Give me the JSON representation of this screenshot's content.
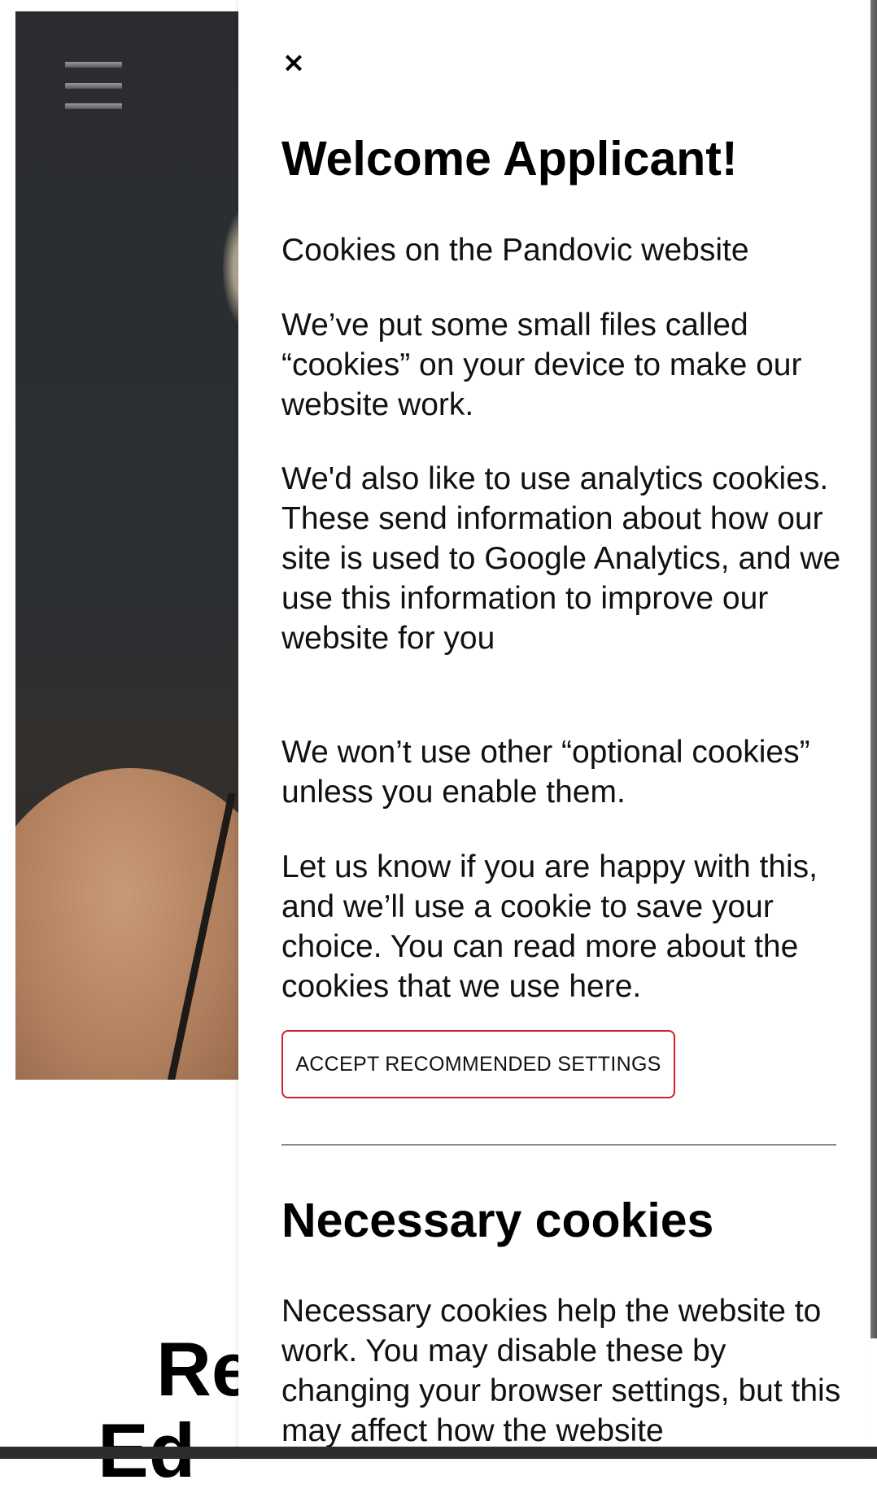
{
  "background": {
    "menu_icon": "hamburger-menu-icon",
    "heading_line1": "Re",
    "heading_line2": "Ed"
  },
  "cookie_panel": {
    "close_icon": "close-icon",
    "close_glyph": "×",
    "title": "Welcome Applicant!",
    "paragraphs": [
      "Cookies on the Pandovic website",
      "We’ve put some small files called “cookies” on your device to make our website work.",
      "We'd also like to use analytics cookies. These send information about how our site is used to Google Analytics, and we use this information to improve our website for you",
      "We won’t use other “optional cookies” unless you enable them.",
      "Let us know if you are happy with this, and we’ll use a cookie to save your choice. You can read more about the cookies that we use here."
    ],
    "accept_button_label": "ACCEPT RECOMMENDED SETTINGS",
    "necessary_section": {
      "title": "Necessary cookies",
      "text": "Necessary cookies help the website to work. You may disable these by changing your browser settings, but this may affect how the website"
    }
  },
  "colors": {
    "accent_border": "#d2202a",
    "panel_background": "#ffffff",
    "text": "#111111"
  }
}
